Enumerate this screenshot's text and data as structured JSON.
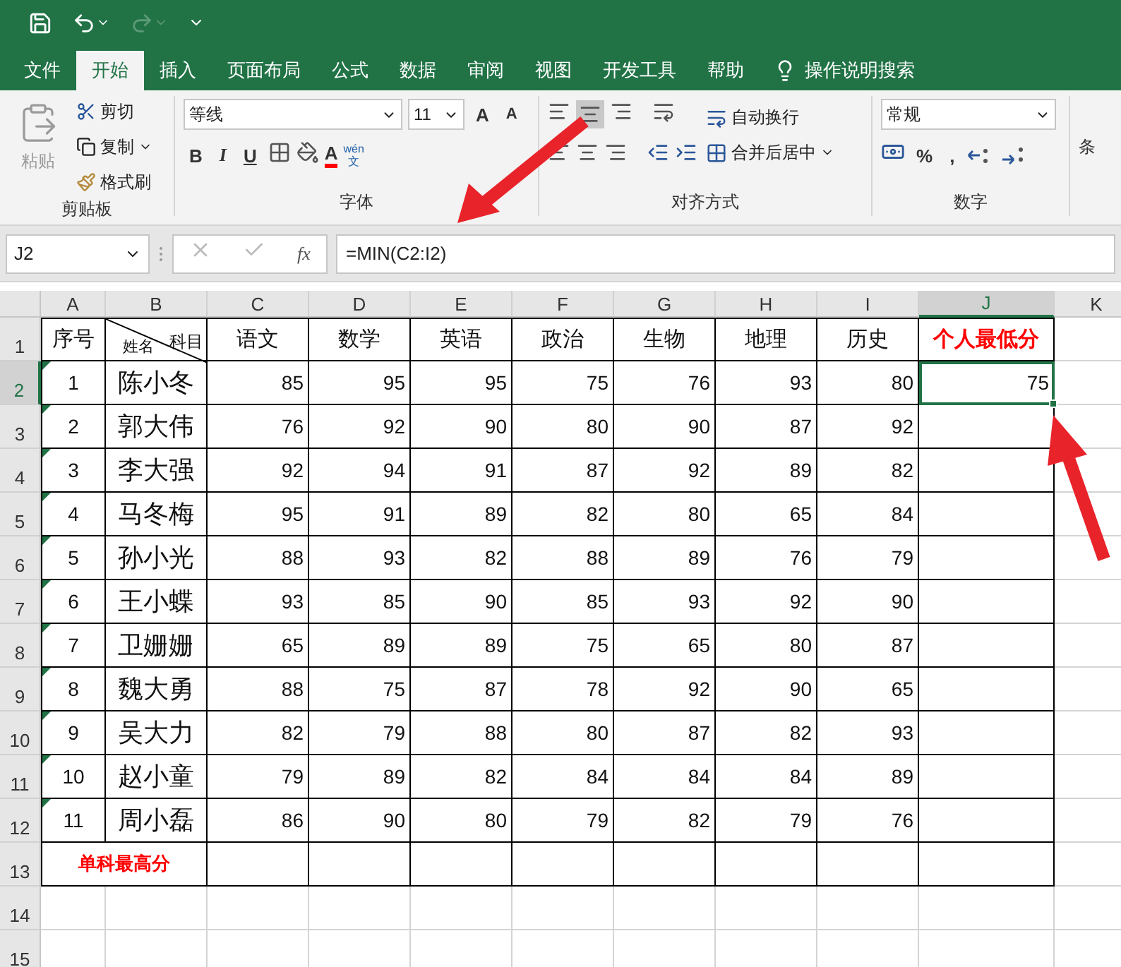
{
  "quick_access": {
    "undo_enabled": true,
    "redo_enabled": false
  },
  "tabs": [
    {
      "label": "文件",
      "selected": false
    },
    {
      "label": "开始",
      "selected": true
    },
    {
      "label": "插入",
      "selected": false
    },
    {
      "label": "页面布局",
      "selected": false
    },
    {
      "label": "公式",
      "selected": false
    },
    {
      "label": "数据",
      "selected": false
    },
    {
      "label": "审阅",
      "selected": false
    },
    {
      "label": "视图",
      "selected": false
    },
    {
      "label": "开发工具",
      "selected": false
    },
    {
      "label": "帮助",
      "selected": false
    }
  ],
  "tell_me": "操作说明搜索",
  "clipboard": {
    "paste": "粘贴",
    "cut": "剪切",
    "copy": "复制",
    "format_painter": "格式刷",
    "label": "剪贴板"
  },
  "font": {
    "name": "等线",
    "size": "11",
    "grow": "A",
    "shrink": "A",
    "bold": "B",
    "italic": "I",
    "underline": "U",
    "font_color": "A",
    "phonetic_top": "wén",
    "phonetic_bottom": "文",
    "label": "字体"
  },
  "alignment": {
    "wrap": "自动换行",
    "merge": "合并后居中",
    "label": "对齐方式"
  },
  "number": {
    "format": "常规",
    "percent": "%",
    "comma": ",",
    "label": "数字"
  },
  "next_group": "条",
  "name_box": "J2",
  "fx": "fx",
  "formula": "=MIN(C2:I2)",
  "columns": [
    {
      "label": "A",
      "selected": false
    },
    {
      "label": "B",
      "selected": false
    },
    {
      "label": "C",
      "selected": false
    },
    {
      "label": "D",
      "selected": false
    },
    {
      "label": "E",
      "selected": false
    },
    {
      "label": "F",
      "selected": false
    },
    {
      "label": "G",
      "selected": false
    },
    {
      "label": "H",
      "selected": false
    },
    {
      "label": "I",
      "selected": false
    },
    {
      "label": "J",
      "selected": true
    },
    {
      "label": "K",
      "selected": false
    }
  ],
  "rows": [
    {
      "header": "1",
      "selected": false,
      "kind": "header",
      "emphasis": true,
      "cells": [
        "序号",
        {
          "top": "科目",
          "bottom": "姓名"
        },
        "语文",
        "数学",
        "英语",
        "政治",
        "生物",
        "地理",
        "历史",
        "个人最低分"
      ]
    },
    {
      "header": "2",
      "selected": true,
      "kind": "data",
      "number_as_text": true,
      "cells": [
        "1",
        "陈小冬",
        "85",
        "95",
        "95",
        "75",
        "76",
        "93",
        "80",
        "75"
      ]
    },
    {
      "header": "3",
      "selected": false,
      "kind": "data",
      "number_as_text": true,
      "cells": [
        "2",
        "郭大伟",
        "76",
        "92",
        "90",
        "80",
        "90",
        "87",
        "92"
      ]
    },
    {
      "header": "4",
      "selected": false,
      "kind": "data",
      "number_as_text": true,
      "cells": [
        "3",
        "李大强",
        "92",
        "94",
        "91",
        "87",
        "92",
        "89",
        "82"
      ]
    },
    {
      "header": "5",
      "selected": false,
      "kind": "data",
      "number_as_text": true,
      "cells": [
        "4",
        "马冬梅",
        "95",
        "91",
        "89",
        "82",
        "80",
        "65",
        "84"
      ]
    },
    {
      "header": "6",
      "selected": false,
      "kind": "data",
      "number_as_text": true,
      "cells": [
        "5",
        "孙小光",
        "88",
        "93",
        "82",
        "88",
        "89",
        "76",
        "79"
      ]
    },
    {
      "header": "7",
      "selected": false,
      "kind": "data",
      "number_as_text": true,
      "cells": [
        "6",
        "王小蝶",
        "93",
        "85",
        "90",
        "85",
        "93",
        "92",
        "90"
      ]
    },
    {
      "header": "8",
      "selected": false,
      "kind": "data",
      "number_as_text": true,
      "cells": [
        "7",
        "卫姗姗",
        "65",
        "89",
        "89",
        "75",
        "65",
        "80",
        "87"
      ]
    },
    {
      "header": "9",
      "selected": false,
      "kind": "data",
      "number_as_text": true,
      "cells": [
        "8",
        "魏大勇",
        "88",
        "75",
        "87",
        "78",
        "92",
        "90",
        "65"
      ]
    },
    {
      "header": "10",
      "selected": false,
      "kind": "data",
      "number_as_text": true,
      "cells": [
        "9",
        "吴大力",
        "82",
        "79",
        "88",
        "80",
        "87",
        "82",
        "93"
      ]
    },
    {
      "header": "11",
      "selected": false,
      "kind": "data",
      "number_as_text": true,
      "cells": [
        "10",
        "赵小童",
        "79",
        "89",
        "82",
        "84",
        "84",
        "84",
        "89"
      ]
    },
    {
      "header": "12",
      "selected": false,
      "kind": "data",
      "number_as_text": true,
      "cells": [
        "11",
        "周小磊",
        "86",
        "90",
        "80",
        "79",
        "82",
        "79",
        "76"
      ]
    },
    {
      "header": "13",
      "selected": false,
      "kind": "summary",
      "cells": [
        "单科最高分"
      ]
    },
    {
      "header": "14",
      "selected": false,
      "kind": "empty",
      "cells": []
    },
    {
      "header": "15",
      "selected": false,
      "kind": "empty",
      "cells": []
    }
  ]
}
